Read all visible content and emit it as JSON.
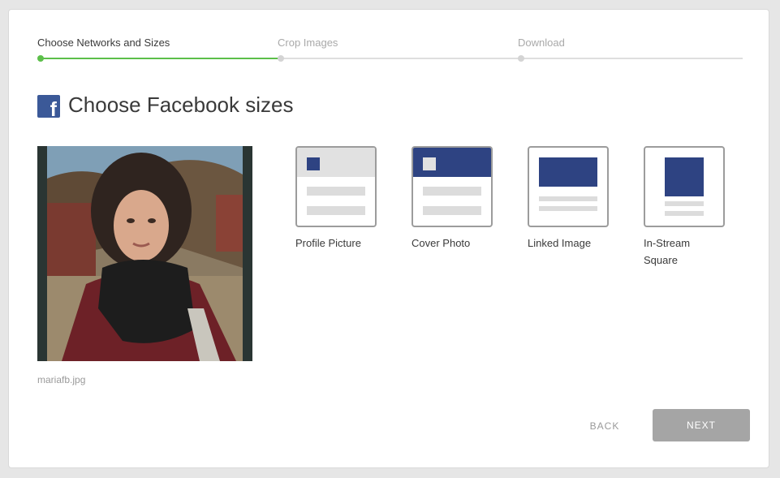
{
  "stepper": {
    "steps": [
      {
        "label": "Choose Networks and Sizes",
        "state": "done"
      },
      {
        "label": "Crop Images",
        "state": "todo"
      },
      {
        "label": "Download",
        "state": "todo"
      }
    ],
    "accent_color": "#5cbf4a"
  },
  "heading": {
    "icon": "facebook-icon",
    "title": "Choose Facebook sizes",
    "brand_color": "#3b5998"
  },
  "source_image": {
    "filename": "mariafb.jpg"
  },
  "size_options": [
    {
      "label": "Profile Picture",
      "icon": "profile-picture-layout-icon"
    },
    {
      "label": "Cover Photo",
      "icon": "cover-photo-layout-icon"
    },
    {
      "label": "Linked Image",
      "icon": "linked-image-layout-icon"
    },
    {
      "label_line1": "In-Stream",
      "label_line2": "Square",
      "icon": "in-stream-square-layout-icon"
    }
  ],
  "actions": {
    "back_label": "BACK",
    "next_label": "NEXT"
  }
}
